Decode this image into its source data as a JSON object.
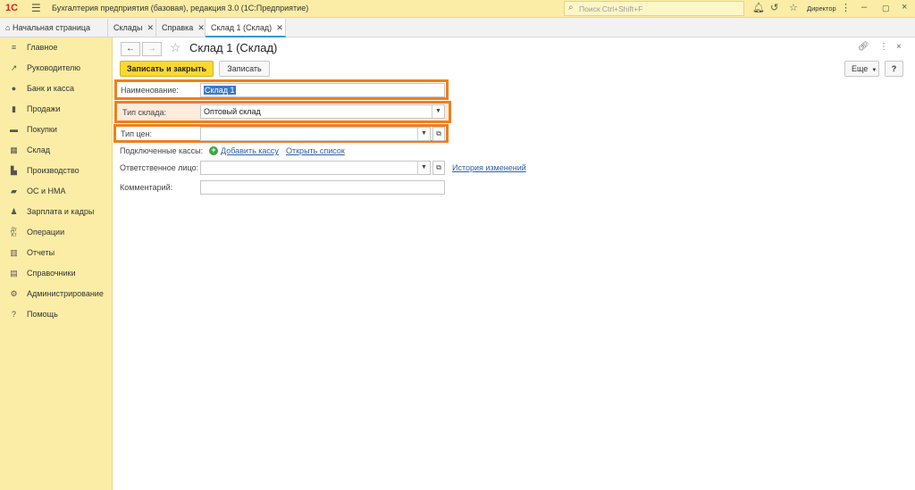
{
  "app": {
    "logo": "1С",
    "title": "Бухгалтерия предприятия (базовая), редакция 3.0  (1С:Предприятие)",
    "search_placeholder": "Поиск Ctrl+Shift+F",
    "user": "Директор"
  },
  "tabs": [
    {
      "label": "Начальная страница"
    },
    {
      "label": "Склады"
    },
    {
      "label": "Справка"
    },
    {
      "label": "Склад 1 (Склад)"
    }
  ],
  "sidebar": {
    "items": [
      {
        "label": "Главное",
        "icon": "menu-icon"
      },
      {
        "label": "Руководителю",
        "icon": "trend-icon"
      },
      {
        "label": "Банк и касса",
        "icon": "coin-icon"
      },
      {
        "label": "Продажи",
        "icon": "bag-icon"
      },
      {
        "label": "Покупки",
        "icon": "cart-icon"
      },
      {
        "label": "Склад",
        "icon": "warehouse-icon"
      },
      {
        "label": "Производство",
        "icon": "factory-icon"
      },
      {
        "label": "ОС и НМА",
        "icon": "truck-icon"
      },
      {
        "label": "Зарплата и кадры",
        "icon": "person-icon"
      },
      {
        "label": "Операции",
        "icon": "dt-kt-icon"
      },
      {
        "label": "Отчеты",
        "icon": "report-icon"
      },
      {
        "label": "Справочники",
        "icon": "book-icon"
      },
      {
        "label": "Администрирование",
        "icon": "gear-icon"
      },
      {
        "label": "Помощь",
        "icon": "help-icon"
      }
    ]
  },
  "form": {
    "title": "Склад 1 (Склад)",
    "save_close_label": "Записать и закрыть",
    "save_label": "Записать",
    "more_label": "Еще",
    "help_label": "?",
    "fields": {
      "name_label": "Наименование:",
      "name_value": "Склад 1",
      "type_label": "Тип склада:",
      "type_value": "Оптовый склад",
      "price_type_label": "Тип цен:",
      "price_type_value": "",
      "cash_label": "Подключенные кассы:",
      "add_cash_link": "Добавить кассу",
      "open_list_link": "Открыть список",
      "responsible_label": "Ответственное лицо:",
      "responsible_value": "",
      "history_link": "История изменений",
      "comment_label": "Комментарий:",
      "comment_value": ""
    }
  },
  "colors": {
    "accent_yellow": "#fbeda5",
    "primary_button": "#f9d930",
    "highlight_orange": "#ef7f1b",
    "link_blue": "#2e5ea6",
    "tab_active_underline": "#2e9dc7"
  }
}
